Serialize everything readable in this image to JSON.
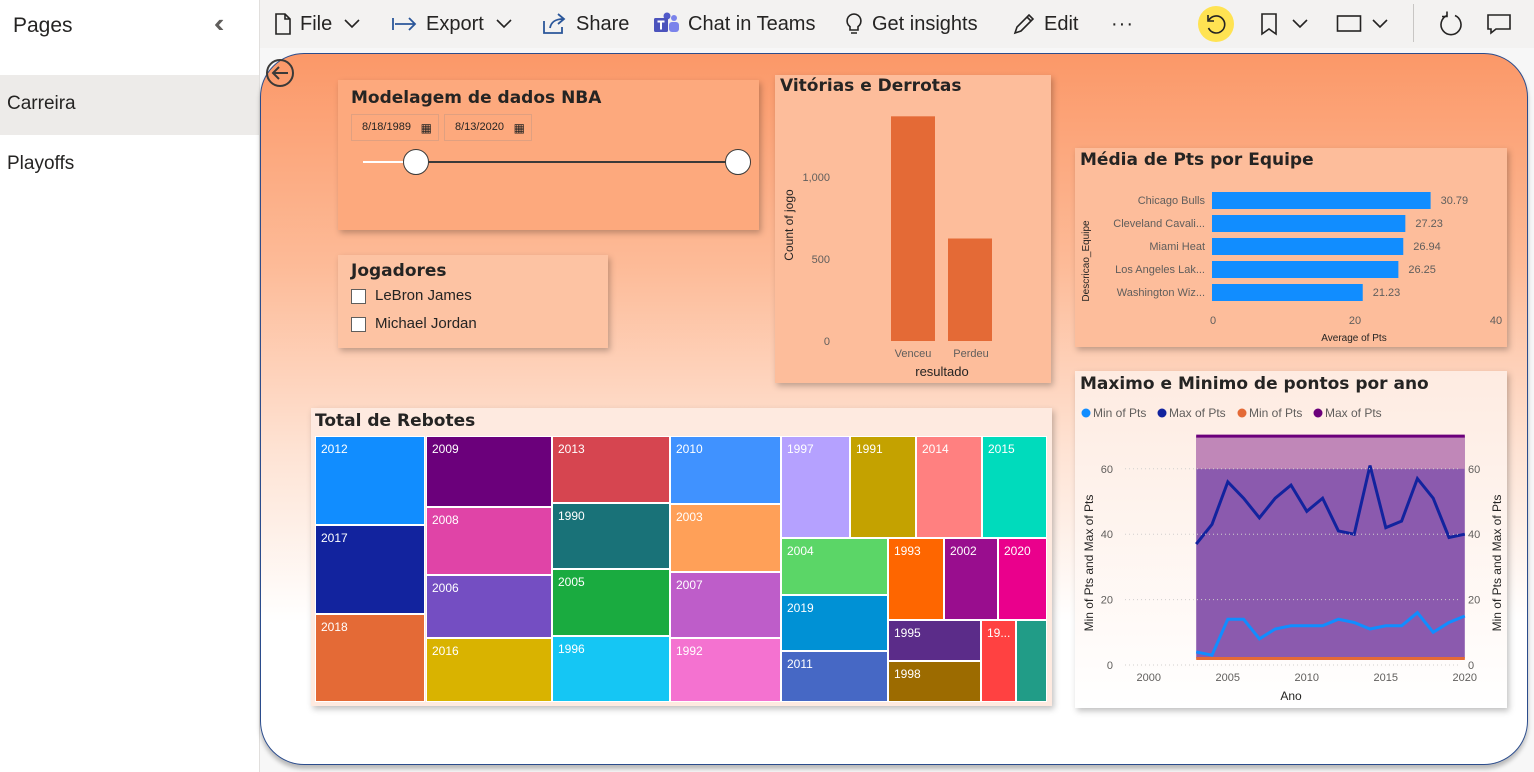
{
  "pages_panel": {
    "title": "Pages",
    "items": [
      {
        "label": "Carreira",
        "active": true
      },
      {
        "label": "Playoffs",
        "active": false
      }
    ]
  },
  "toolbar": {
    "file": "File",
    "export": "Export",
    "share": "Share",
    "chat": "Chat in Teams",
    "insights": "Get insights",
    "edit": "Edit",
    "more": "···"
  },
  "slicer_date": {
    "title": "Modelagem de dados NBA",
    "start": "8/18/1989",
    "end": "8/13/2020",
    "range_position": [
      0.12,
      1.0
    ]
  },
  "slicer_players": {
    "title": "Jogadores",
    "options": [
      {
        "label": "LeBron James",
        "checked": false
      },
      {
        "label": "Michael Jordan",
        "checked": false
      }
    ]
  },
  "win_loss": {
    "title": "Vitórias e Derrotas",
    "xlabel": "resultado",
    "ylabel": "Count of jogo",
    "tick_labels": [
      "0",
      "500",
      "1,000"
    ]
  },
  "team_avg": {
    "title": "Média de Pts por Equipe",
    "ylabel": "Descricao_Equipe",
    "xlabel": "Average of Pts",
    "tick_labels": [
      "0",
      "20",
      "40"
    ],
    "value_labels": [
      "30.79",
      "27.23",
      "26.94",
      "26.25",
      "21.23"
    ]
  },
  "rebounds": {
    "title": "Total de Rebotes",
    "tiles": [
      "2012",
      "2017",
      "2018",
      "2009",
      "2008",
      "2006",
      "2016",
      "2013",
      "1990",
      "2005",
      "1996",
      "2010",
      "2003",
      "2007",
      "1992",
      "1997",
      "1991",
      "2014",
      "2015",
      "2004",
      "1993",
      "2002",
      "2020",
      "2019",
      "1995",
      "2011",
      "1998",
      "19..."
    ]
  },
  "maxmin": {
    "title": "Maximo e Minimo de pontos por ano",
    "legend": [
      "Min of Pts",
      "Max of Pts",
      "Min of Pts",
      "Max of Pts"
    ],
    "xlabel": "Ano",
    "ylabel_left": "Min of Pts and Max of Pts",
    "ylabel_right": "Min of Pts and Max of Pts",
    "x_ticks": [
      "2000",
      "2005",
      "2010",
      "2015",
      "2020"
    ],
    "y_ticks": [
      "0",
      "20",
      "40",
      "60"
    ]
  },
  "colors": {
    "accent_bar": "#e46a36",
    "team_bar": "#118dff",
    "max_line": "#12239e",
    "min_line": "#118dff",
    "area": "#8b5aae",
    "report_border": "#2b4c8c"
  },
  "chart_data": [
    {
      "type": "bar",
      "title": "Vitórias e Derrotas",
      "categories": [
        "Venceu",
        "Perdeu"
      ],
      "values": [
        1370,
        625
      ],
      "xlabel": "resultado",
      "ylabel": "Count of jogo",
      "ylim": [
        0,
        1500
      ]
    },
    {
      "type": "bar",
      "orientation": "horizontal",
      "title": "Média de Pts por Equipe",
      "categories": [
        "Chicago Bulls",
        "Cleveland Cavali...",
        "Miami Heat",
        "Los Angeles Lak...",
        "Washington Wiz..."
      ],
      "values": [
        30.79,
        27.23,
        26.94,
        26.25,
        21.23
      ],
      "xlabel": "Average of Pts",
      "ylabel": "Descricao_Equipe",
      "xlim": [
        0,
        40
      ]
    },
    {
      "type": "line",
      "title": "Maximo e Minimo de pontos por ano",
      "x": [
        2003,
        2004,
        2005,
        2006,
        2007,
        2008,
        2009,
        2010,
        2011,
        2012,
        2013,
        2014,
        2015,
        2016,
        2017,
        2018,
        2019,
        2020
      ],
      "series": [
        {
          "name": "Max of Pts",
          "values": [
            37,
            43,
            56,
            51,
            45,
            51,
            55,
            47,
            51,
            41,
            40,
            61,
            42,
            44,
            57,
            51,
            39,
            40
          ]
        },
        {
          "name": "Min of Pts",
          "values": [
            4,
            3,
            14,
            14,
            8,
            11,
            12,
            12,
            12,
            14,
            13,
            11,
            12,
            12,
            16,
            10,
            13,
            15
          ]
        }
      ],
      "xlabel": "Ano",
      "ylabel": "Min of Pts and Max of Pts",
      "xlim": [
        1999,
        2021
      ],
      "ylim": [
        0,
        70
      ]
    },
    {
      "type": "treemap",
      "title": "Total de Rebotes",
      "categories": [
        "2012",
        "2017",
        "2018",
        "2009",
        "2008",
        "2006",
        "2016",
        "2013",
        "1990",
        "2005",
        "1996",
        "2010",
        "2003",
        "2007",
        "1992",
        "1997",
        "1991",
        "2014",
        "2015",
        "2004",
        "1993",
        "2002",
        "2020",
        "2019",
        "1995",
        "2011",
        "1998",
        "19..."
      ]
    }
  ]
}
